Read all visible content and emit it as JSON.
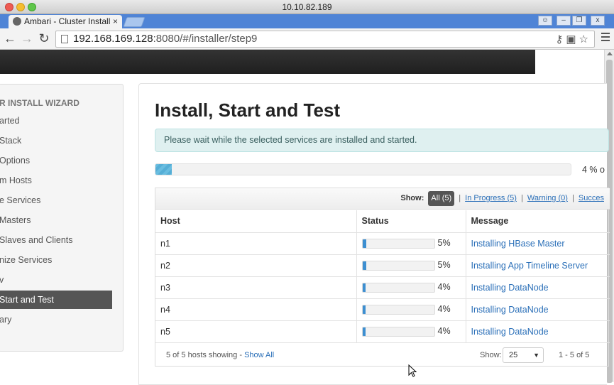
{
  "os": {
    "title": "10.10.82.189"
  },
  "browser": {
    "tab_title": "Ambari - Cluster Install",
    "tab_close": "×",
    "url_host": "192.168.169.128",
    "url_rest": ":8080/#/installer/step9",
    "icons": [
      "key-icon",
      "translate-icon",
      "star-icon",
      "menu-icon"
    ]
  },
  "sidebar": {
    "title": "R INSTALL WIZARD",
    "items": [
      {
        "label": "arted",
        "active": false
      },
      {
        "label": " Stack",
        "active": false
      },
      {
        "label": "Options",
        "active": false
      },
      {
        "label": "m Hosts",
        "active": false
      },
      {
        "label": "e Services",
        "active": false
      },
      {
        "label": " Masters",
        "active": false
      },
      {
        "label": " Slaves and Clients",
        "active": false
      },
      {
        "label": "nize Services",
        "active": false
      },
      {
        "label": "v",
        "active": false
      },
      {
        "label": " Start and Test",
        "active": true
      },
      {
        "label": "ary",
        "active": false
      }
    ]
  },
  "main": {
    "title": "Install, Start and Test",
    "alert": "Please wait while the selected services are installed and started.",
    "overall_progress": {
      "percent": 4,
      "label": "4 % o"
    },
    "filters": {
      "show_label": "Show:",
      "all": "All (5)",
      "in_progress": "In Progress (5)",
      "warning": "Warning (0)",
      "success": "Succes",
      "sep": "|"
    },
    "table": {
      "headers": {
        "host": "Host",
        "status": "Status",
        "message": "Message"
      },
      "rows": [
        {
          "host": "n1",
          "percent": 5,
          "pct_label": "5%",
          "message": "Installing HBase Master"
        },
        {
          "host": "n2",
          "percent": 5,
          "pct_label": "5%",
          "message": "Installing App Timeline Server"
        },
        {
          "host": "n3",
          "percent": 4,
          "pct_label": "4%",
          "message": "Installing DataNode"
        },
        {
          "host": "n4",
          "percent": 4,
          "pct_label": "4%",
          "message": "Installing DataNode"
        },
        {
          "host": "n5",
          "percent": 4,
          "pct_label": "4%",
          "message": "Installing DataNode"
        }
      ]
    },
    "footer": {
      "hosts_showing": "5 of 5 hosts showing - ",
      "show_all": "Show All",
      "show_label": "Show:",
      "page_size": "25",
      "range": "1 - 5 of 5"
    }
  }
}
